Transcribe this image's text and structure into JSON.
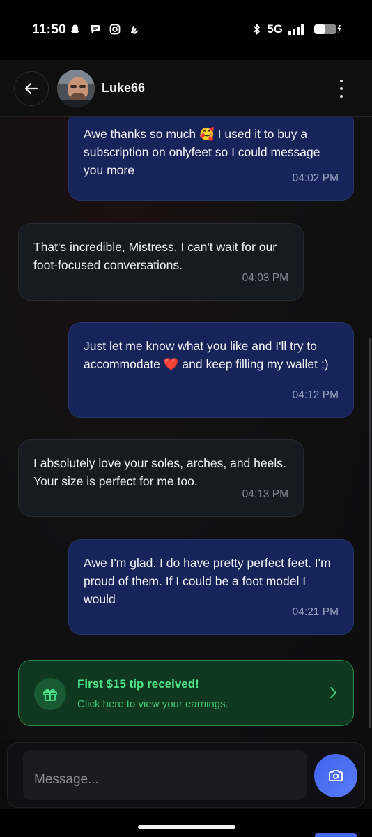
{
  "status_bar": {
    "time": "11:50",
    "network": "5G",
    "left_icons": [
      "snapchat-icon",
      "chat-icon",
      "instagram-icon",
      "notification-icon"
    ],
    "right_icons": [
      "bluetooth-icon",
      "signal-icon",
      "battery-charging-icon"
    ]
  },
  "header": {
    "contact_name": "Luke66",
    "back_icon": "arrow-left-icon",
    "menu_icon": "more-vertical-icon"
  },
  "messages": [
    {
      "direction": "out",
      "text": "Awe thanks so much 🥰 I used it to buy a subscription on onlyfeet so I could message you more",
      "time": "04:02 PM"
    },
    {
      "direction": "in",
      "text": "That's incredible, Mistress. I can't wait for our foot-focused conversations.",
      "time": "04:03 PM"
    },
    {
      "direction": "out",
      "text": "Just let me know what you like and I'll try to accommodate ❤️ and keep filling my wallet ;)",
      "time": "04:12 PM"
    },
    {
      "direction": "in",
      "text": "I absolutely love your soles, arches, and heels. Your size is perfect for me too.",
      "time": "04:13 PM"
    },
    {
      "direction": "out",
      "text": "Awe I'm glad. I do have pretty perfect feet. I'm proud of them. If I could be a foot model I would",
      "time": "04:21 PM"
    }
  ],
  "tip_banner": {
    "title": "First $15 tip received!",
    "subtitle": "Click here to view your earnings.",
    "icon": "gift-icon",
    "accent_color": "#4fe58a"
  },
  "composer": {
    "placeholder": "Message...",
    "camera_icon": "camera-icon",
    "accent_color": "#4a6cf0"
  }
}
